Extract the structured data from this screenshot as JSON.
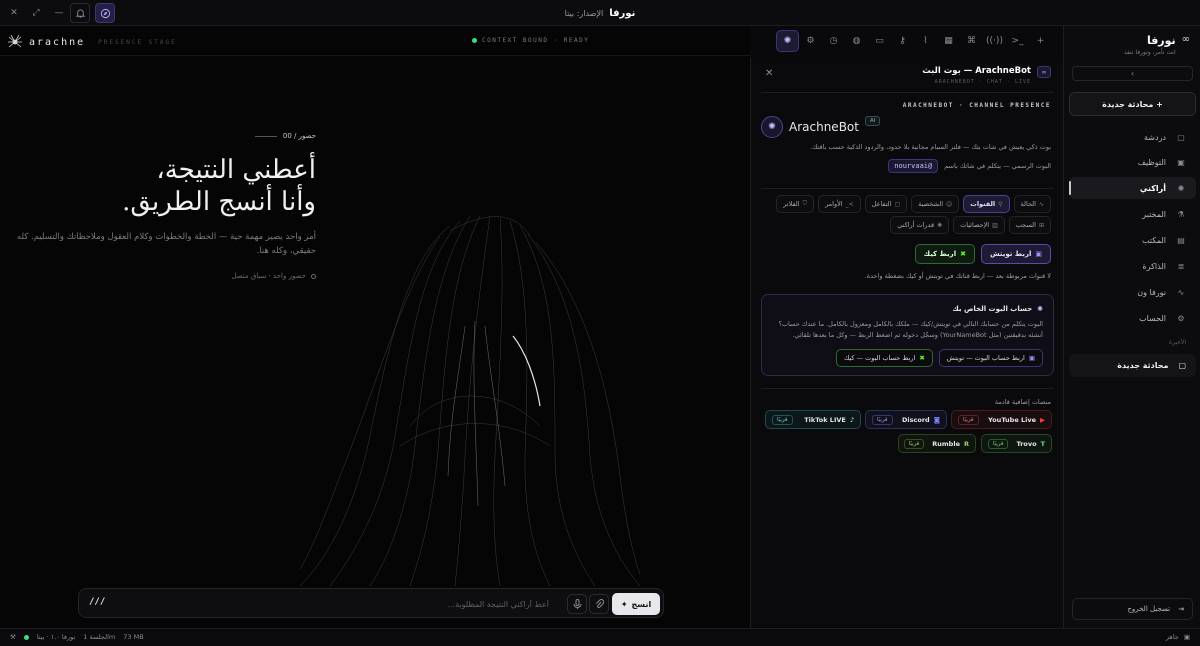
{
  "titlebar": {
    "app_name": "نورفا",
    "version": "الإصدار: بيتا"
  },
  "stage": {
    "brand": "arachne",
    "brand_sub": "PRESENCE STAGE",
    "context": "CONTEXT BOUND · READY",
    "hero": {
      "kicker": "حضور / 00",
      "line1": "أعطني النتيجة،",
      "line2": "وأنا أنسج الطريق.",
      "desc": "أمر واحد يصير مهمة حية — الخطة والخطوات وكلام العقول وملاحظاتك والتسليم. كله حقيقي، وكله هنا.",
      "meta": "حضور واحد · سياق متصل"
    },
    "composer": {
      "prefix": "///",
      "placeholder": "أعط أراكني النتيجة المطلوبة...",
      "send_label": "انسج"
    }
  },
  "panel": {
    "title": "ArachneBot — بوت البث",
    "subtitle": "ARACHNEBOT · CHAT · LIVE",
    "section_label": "ARACHNEBOT · CHANNEL PRESENCE",
    "bot_name": "ArachneBot",
    "ai_badge": "AI",
    "description": "بوت ذكي يعيش في شات بثك — فلتر السبام مجانية بلا حدود، والردود الذكية حسب باقتك.",
    "owner_text": "البوت الرسمي — يتكلم في شاتك باسم",
    "owner_handle": "@nourvaai",
    "tabs_row1": [
      "الحالة",
      "القنوات",
      "الشخصية",
      "التفاعل",
      "الأوامر",
      "الفلاتر"
    ],
    "tabs_row2": [
      "السجب",
      "الإحصائيات",
      "قدرات أراكني"
    ],
    "connect_twitch": "اربط تويتش",
    "connect_kick": "اربط كيك",
    "note": "لا قنوات مربوطة بعد — اربط قناتك في تويتش أو كيك بضغطة واحدة.",
    "own_card": {
      "title": "حساب البوت الخاص بك",
      "desc": "البوت يتكلم من حسابك التالي في تويتش/كيك — ملكك بالكامل ومعزول بالكامل. ما عندك حساب؟ أنشئه بدقيقتين (مثل YourNameBot) وسجّل دخوله ثم اضغط الربط — وكل ما بعدها تلقائي.",
      "btn_twitch": "اربط حساب البوت — تويتش",
      "btn_kick": "اربط حساب البوت — كيك"
    },
    "more_label": "منصات إضافية قادمة",
    "soon": "قريبًا",
    "platforms": {
      "youtube": "YouTube Live",
      "discord": "Discord",
      "tiktok": "TikTok LIVE",
      "trovo": "Trovo",
      "rumble": "Rumble"
    }
  },
  "sidebar": {
    "app_name": "نورفا",
    "tagline": "انت تأمر، ونورفا تنفذ",
    "new_chat": "+ محادثة جديدة",
    "items": [
      "دردشة",
      "التوظيف",
      "أراكني",
      "المختبر",
      "المكتب",
      "الذاكرة",
      "نورفا ون",
      "الحساب"
    ],
    "recent_label": "الأخيرة",
    "recent_chat": "محادثة جديدة",
    "logout": "تسجيل الخروج"
  },
  "statusbar": {
    "build": "نورفا ١.٠ · بيتا",
    "session": "الجلسة 1m",
    "memory": "73 MB",
    "status": "جاهز"
  }
}
